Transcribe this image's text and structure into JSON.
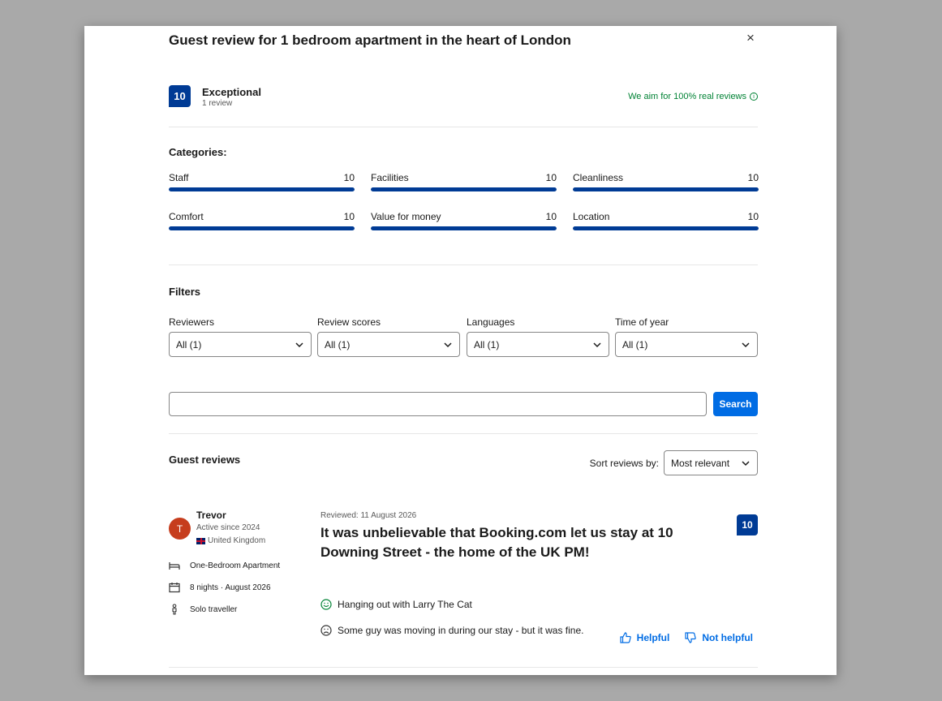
{
  "modal": {
    "title": "Guest review for 1 bedroom apartment in the heart of London",
    "close_glyph": "×"
  },
  "score": {
    "value": "10",
    "word": "Exceptional",
    "count": "1 review",
    "real_reviews_text": "We aim for 100% real reviews",
    "info_glyph": "i"
  },
  "categories": {
    "title": "Categories:",
    "items": [
      {
        "label": "Staff",
        "value": "10",
        "fraction": 1.0
      },
      {
        "label": "Facilities",
        "value": "10",
        "fraction": 1.0
      },
      {
        "label": "Cleanliness",
        "value": "10",
        "fraction": 1.0
      },
      {
        "label": "Comfort",
        "value": "10",
        "fraction": 1.0
      },
      {
        "label": "Value for money",
        "value": "10",
        "fraction": 1.0
      },
      {
        "label": "Location",
        "value": "10",
        "fraction": 1.0
      }
    ]
  },
  "filters": {
    "title": "Filters",
    "items": [
      {
        "label": "Reviewers",
        "value": "All (1)"
      },
      {
        "label": "Review scores",
        "value": "All (1)"
      },
      {
        "label": "Languages",
        "value": "All (1)"
      },
      {
        "label": "Time of year",
        "value": "All (1)"
      }
    ]
  },
  "search": {
    "value": "",
    "button_label": "Search"
  },
  "guest_reviews": {
    "title": "Guest reviews",
    "sort_label": "Sort reviews by:",
    "sort_value": "Most relevant"
  },
  "review": {
    "avatar_initial": "T",
    "name": "Trevor",
    "active_since": "Active since 2024",
    "country": "United Kingdom",
    "room_type": "One-Bedroom Apartment",
    "stay": "8 nights · August 2026",
    "traveller_type": "Solo traveller",
    "reviewed_date": "Reviewed: 11 August 2026",
    "title": "It was unbelievable that Booking.com let us stay at 10 Downing Street - the home of the UK PM!",
    "score": "10",
    "positive": "Hanging out with Larry The Cat",
    "negative": "Some guy was moving in during our stay - but it was fine.",
    "helpful_label": "Helpful",
    "not_helpful_label": "Not helpful"
  },
  "colors": {
    "brand_dark_blue": "#003b95",
    "action_blue": "#006ce4",
    "positive_green": "#008234",
    "avatar_red": "#c63d1d"
  }
}
